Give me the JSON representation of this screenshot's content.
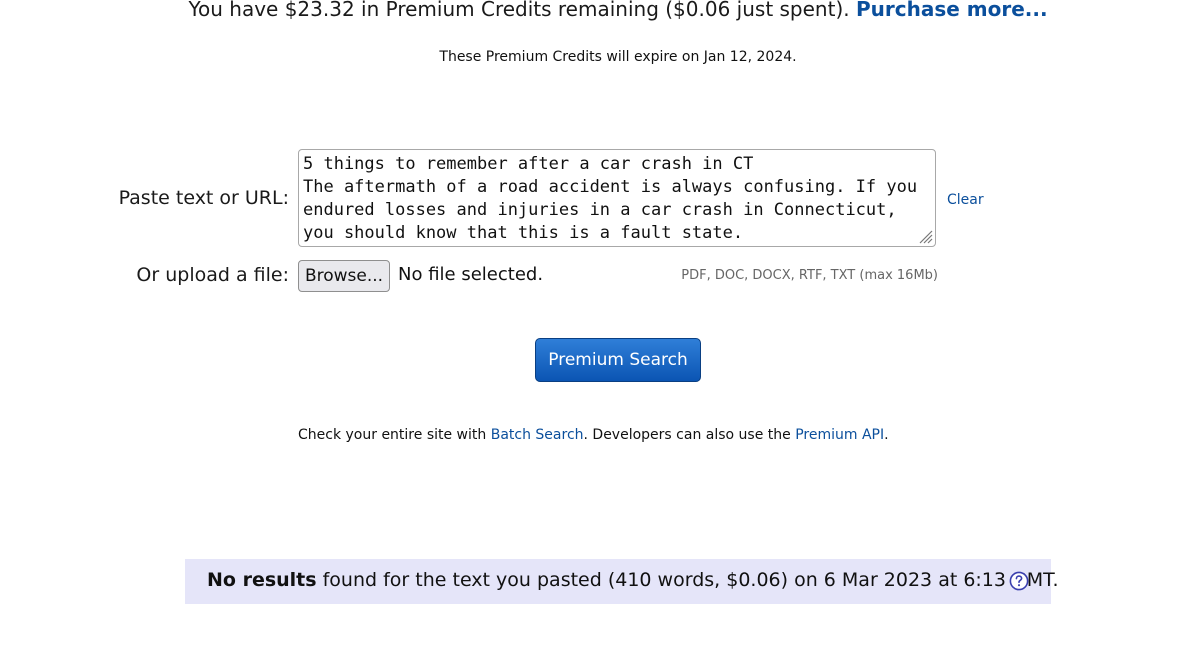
{
  "credits": {
    "prefix": "You have $23.32 in Premium Credits remaining ($0.06 just spent).",
    "purchase_link": "Purchase more..."
  },
  "expiry": "These Premium Credits will expire on Jan 12, 2024.",
  "form": {
    "paste_label": "Paste text or URL:",
    "paste_value": "5 things to remember after a car crash in CT\nThe aftermath of a road accident is always confusing. If you endured losses and injuries in a car crash in Connecticut, you should know that this is a fault state.",
    "clear_link": "Clear",
    "upload_label": "Or upload a file:",
    "browse_button": "Browse...",
    "no_file": "No file selected.",
    "file_types": "PDF, DOC, DOCX, RTF, TXT (max 16Mb)",
    "search_button": "Premium Search"
  },
  "batch": {
    "text1": "Check your entire site with ",
    "batch_link": "Batch Search",
    "text2": ". Developers can also use the ",
    "api_link": "Premium API",
    "text3": "."
  },
  "results": {
    "bold": "No results",
    "text": " found for the text you pasted (410 words, $0.06) on 6 Mar 2023 at 6:13 GMT.",
    "help_icon": "question-circle-icon",
    "bar_color": "#e5e5f9"
  },
  "colors": {
    "link": "#0b4f9c",
    "button": "#0b55b3"
  }
}
